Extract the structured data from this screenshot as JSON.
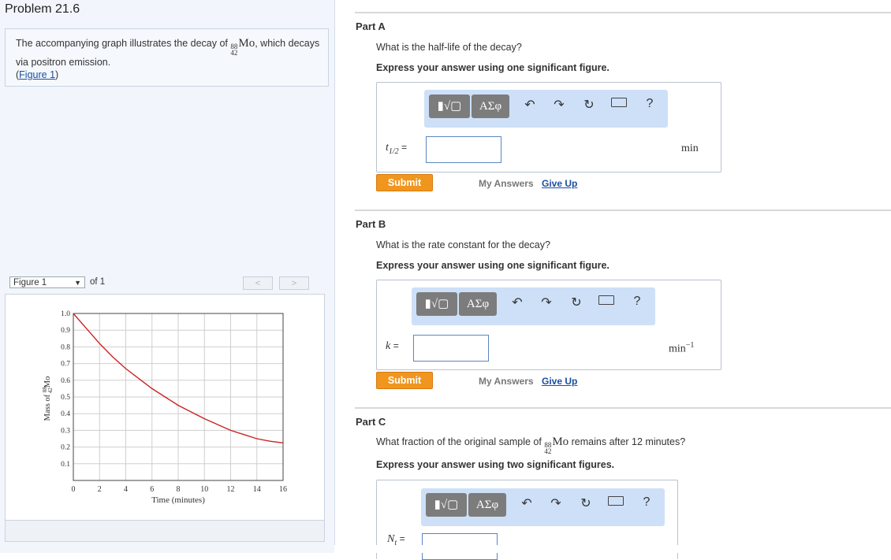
{
  "problem": {
    "title": "Problem 21.6",
    "intro_before": "The accompanying graph illustrates the decay of",
    "isotope": {
      "mass": "88",
      "atomic": "42",
      "symbol": "Mo"
    },
    "intro_after": ", which decays via positron emission.",
    "figure_link": "Figure 1"
  },
  "figure_nav": {
    "selected": "Figure 1",
    "of_label": "of 1",
    "prev": "<",
    "next": ">"
  },
  "chart_data": {
    "type": "line",
    "title": "",
    "xlabel": "Time (minutes)",
    "ylabel": "Mass of 88/42 Mo",
    "ylabel_prefix": "Mass of",
    "ylabel_mass": "88",
    "ylabel_atomic": "42",
    "ylabel_symbol": "Mo",
    "xlim": [
      0,
      16
    ],
    "ylim": [
      0,
      1.0
    ],
    "xticks": [
      0,
      2,
      4,
      6,
      8,
      10,
      12,
      14,
      16
    ],
    "yticks": [
      0.1,
      0.2,
      0.3,
      0.4,
      0.5,
      0.6,
      0.7,
      0.8,
      0.9,
      1.0
    ],
    "ytick_labels": [
      "0.1",
      "0.2",
      "0.3",
      "0.4",
      "0.5",
      "0.6",
      "0.7",
      "0.8",
      "0.9",
      "1.0"
    ],
    "grid": true,
    "series_color": "#cc2222",
    "x": [
      0,
      1,
      2,
      3,
      4,
      5,
      6,
      7,
      8,
      9,
      10,
      11,
      12,
      13,
      14,
      15,
      16
    ],
    "y": [
      1.0,
      0.91,
      0.82,
      0.74,
      0.67,
      0.61,
      0.55,
      0.5,
      0.45,
      0.41,
      0.37,
      0.335,
      0.3,
      0.275,
      0.25,
      0.235,
      0.225
    ]
  },
  "parts": {
    "a": {
      "title": "Part A",
      "question": "What is the half-life of the decay?",
      "instruction": "Express your answer using one significant figure.",
      "var_main": "t",
      "var_sub": "1/2",
      "equals": "=",
      "value": "",
      "unit": "min",
      "submit": "Submit",
      "my_answers": "My Answers",
      "give_up": "Give Up"
    },
    "b": {
      "title": "Part B",
      "question": "What is the rate constant for the decay?",
      "instruction": "Express your answer using one significant figure.",
      "var_main": "k",
      "equals": "=",
      "value": "",
      "unit": "min",
      "unit_sup": "−1",
      "submit": "Submit",
      "my_answers": "My Answers",
      "give_up": "Give Up"
    },
    "c": {
      "title": "Part C",
      "question_before": "What fraction of the original sample of",
      "question_after": "remains after 12 minutes?",
      "instruction": "Express your answer using two significant figures.",
      "var_main": "N",
      "var_sub": "t",
      "equals": "=",
      "value": ""
    }
  },
  "toolbar": {
    "template_label": "▮√▢",
    "greek_label": "ΑΣφ",
    "undo": "↶",
    "redo": "↷",
    "reset": "↻",
    "help": "?"
  },
  "colors": {
    "submit": "#f0961e",
    "toolbar_bg": "#cde0f8",
    "link": "#1a4fa0"
  }
}
